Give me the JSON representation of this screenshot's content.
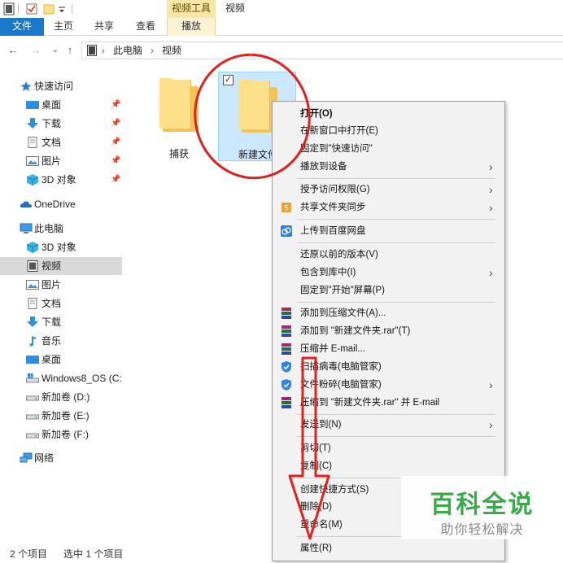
{
  "window": {
    "contextual_tools_label": "视频工具",
    "title": "视频"
  },
  "ribbon": {
    "tabs": [
      "文件",
      "主页",
      "共享",
      "查看",
      "播放"
    ]
  },
  "address": {
    "crumbs": [
      "此电脑",
      "视频"
    ]
  },
  "sidebar": {
    "items": [
      {
        "label": "快速访问",
        "icon": "star-icon"
      },
      {
        "label": "桌面",
        "icon": "desktop-icon",
        "pinned": true
      },
      {
        "label": "下载",
        "icon": "download-icon",
        "pinned": true
      },
      {
        "label": "文档",
        "icon": "document-icon",
        "pinned": true
      },
      {
        "label": "图片",
        "icon": "picture-icon",
        "pinned": true
      },
      {
        "label": "3D 对象",
        "icon": "cube-icon",
        "pinned": true
      },
      {
        "label": "OneDrive",
        "icon": "cloud-icon"
      },
      {
        "label": "此电脑",
        "icon": "computer-icon"
      },
      {
        "label": "3D 对象",
        "icon": "cube-icon"
      },
      {
        "label": "视频",
        "icon": "video-icon",
        "selected": true
      },
      {
        "label": "图片",
        "icon": "picture-icon"
      },
      {
        "label": "文档",
        "icon": "document-icon"
      },
      {
        "label": "下载",
        "icon": "download-icon"
      },
      {
        "label": "音乐",
        "icon": "music-icon"
      },
      {
        "label": "桌面",
        "icon": "desktop-icon"
      },
      {
        "label": "Windows8_OS (C:",
        "icon": "drive-icon"
      },
      {
        "label": "新加卷 (D:)",
        "icon": "drive-icon"
      },
      {
        "label": "新加卷 (E:)",
        "icon": "drive-icon"
      },
      {
        "label": "新加卷 (F:)",
        "icon": "drive-icon"
      },
      {
        "label": "网络",
        "icon": "network-icon"
      }
    ]
  },
  "files": [
    {
      "name": "捕获",
      "selected": false
    },
    {
      "name": "新建文件",
      "selected": true
    }
  ],
  "status": {
    "count": "2 个项目",
    "selection": "选中 1 个项目"
  },
  "context_menu": {
    "items": [
      {
        "label": "打开(O)",
        "bold": true
      },
      {
        "label": "在新窗口中打开(E)"
      },
      {
        "label": "固定到\"快速访问\""
      },
      {
        "label": "播放到设备",
        "submenu": true
      },
      {
        "sep": true
      },
      {
        "label": "授予访问权限(G)",
        "submenu": true
      },
      {
        "label": "共享文件夹同步",
        "submenu": true,
        "icon": "sync-icon"
      },
      {
        "sep": true
      },
      {
        "label": "上传到百度网盘",
        "icon": "baidu-cloud-icon"
      },
      {
        "sep": true
      },
      {
        "label": "还原以前的版本(V)"
      },
      {
        "label": "包含到库中(I)",
        "submenu": true
      },
      {
        "label": "固定到\"开始\"屏幕(P)"
      },
      {
        "sep": true
      },
      {
        "label": "添加到压缩文件(A)...",
        "icon": "winrar-icon"
      },
      {
        "label": "添加到 \"新建文件夹.rar\"(T)",
        "icon": "winrar-icon"
      },
      {
        "label": "压缩并 E-mail...",
        "icon": "winrar-icon"
      },
      {
        "label": "扫描病毒(电脑管家)",
        "icon": "shield-icon"
      },
      {
        "label": "文件粉碎(电脑管家)",
        "submenu": true,
        "icon": "shield-icon"
      },
      {
        "label": "压缩到 \"新建文件夹.rar\" 并 E-mail",
        "icon": "winrar-icon"
      },
      {
        "sep": true
      },
      {
        "label": "发送到(N)",
        "submenu": true
      },
      {
        "sep": true
      },
      {
        "label": "剪切(T)"
      },
      {
        "label": "复制(C)"
      },
      {
        "sep": true
      },
      {
        "label": "创建快捷方式(S)"
      },
      {
        "label": "删除(D)"
      },
      {
        "label": "重命名(M)"
      },
      {
        "sep": true
      },
      {
        "label": "属性(R)"
      }
    ]
  },
  "watermark": {
    "title": "百科全说",
    "subtitle": "助你轻松解决"
  },
  "colors": {
    "accent": "#1979ca",
    "annotation": "#e0211d",
    "watermark_green": "#3aa94a"
  }
}
